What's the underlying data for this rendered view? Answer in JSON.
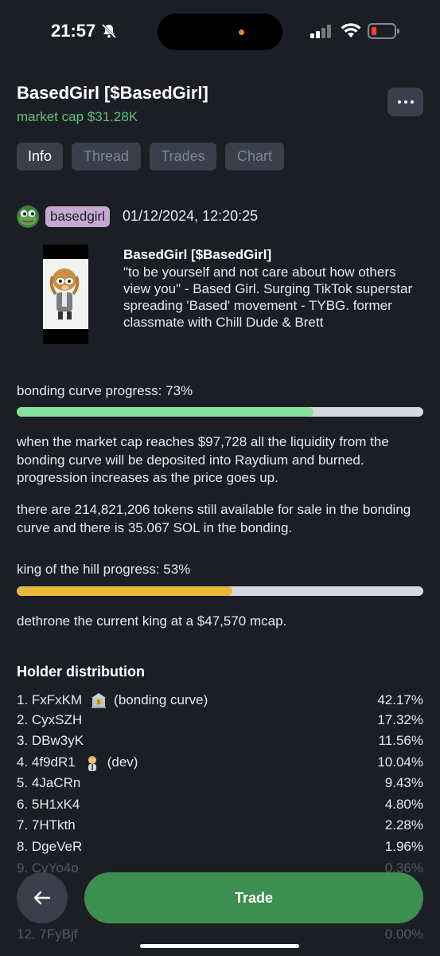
{
  "status": {
    "time": "21:57",
    "icons": [
      "bell-slash-icon",
      "signal-icon",
      "wifi-icon",
      "battery-low-icon"
    ],
    "battery_color": "#ff3b30"
  },
  "header": {
    "title": "BasedGirl [$BasedGirl]",
    "market_cap": "market cap $31.28K",
    "market_cap_color": "#5ec27a"
  },
  "tabs": [
    {
      "label": "Info",
      "active": true
    },
    {
      "label": "Thread",
      "active": false
    },
    {
      "label": "Trades",
      "active": false
    },
    {
      "label": "Chart",
      "active": false
    }
  ],
  "creator": {
    "username": "basedgirl",
    "created_at": "01/12/2024, 12:20:25",
    "badge_color": "#c6a9d1"
  },
  "token": {
    "name": "BasedGirl [$BasedGirl]",
    "description": "\"to be yourself and not care about how others view you\" - Based Girl. Surging TikTok superstar spreading 'Based' movement - TYBG.  former classmate with Chill Dude & Brett"
  },
  "bonding_curve": {
    "label": "bonding curve progress: 73%",
    "progress": 0.73,
    "color": "#86e09a",
    "info_1": "when the market cap reaches $97,728 all the liquidity from the bonding curve will be deposited into Raydium and burned. progression increases as the price goes up.",
    "info_2": "there are 214,821,206 tokens still available for sale in the bonding curve and there is 35.067 SOL in the bonding."
  },
  "king_of_hill": {
    "label": "king of the hill progress: 53%",
    "progress": 0.53,
    "color": "#e8b93a",
    "info": "dethrone the current king at a $47,570 mcap."
  },
  "holders": {
    "title": "Holder distribution",
    "rows": [
      {
        "name": "1. FxFxKM",
        "tag_icon": "bank-icon",
        "tag": "(bonding curve)",
        "pct": "42.17%",
        "faded": false
      },
      {
        "name": "2. CyxSZH",
        "tag_icon": "",
        "tag": "",
        "pct": "17.32%",
        "faded": false
      },
      {
        "name": "3. DBw3yK",
        "tag_icon": "",
        "tag": "",
        "pct": "11.56%",
        "faded": false
      },
      {
        "name": "4. 4f9dR1",
        "tag_icon": "person-icon",
        "tag": "(dev)",
        "pct": "10.04%",
        "faded": false
      },
      {
        "name": "5. 4JaCRn",
        "tag_icon": "",
        "tag": "",
        "pct": "9.43%",
        "faded": false
      },
      {
        "name": "6. 5H1xK4",
        "tag_icon": "",
        "tag": "",
        "pct": "4.80%",
        "faded": false
      },
      {
        "name": "7. 7HTkth",
        "tag_icon": "",
        "tag": "",
        "pct": "2.28%",
        "faded": false
      },
      {
        "name": "8. DgeVeR",
        "tag_icon": "",
        "tag": "",
        "pct": "1.96%",
        "faded": false
      },
      {
        "name": "9. CvYo4o",
        "tag_icon": "",
        "tag": "",
        "pct": "0.36%",
        "faded": true
      },
      {
        "name": "12. 7FyBjf",
        "tag_icon": "",
        "tag": "",
        "pct": "0.00%",
        "faded": true
      }
    ]
  },
  "actions": {
    "trade_label": "Trade",
    "trade_color": "#3d8f4f",
    "back_icon": "arrow-left-icon"
  }
}
